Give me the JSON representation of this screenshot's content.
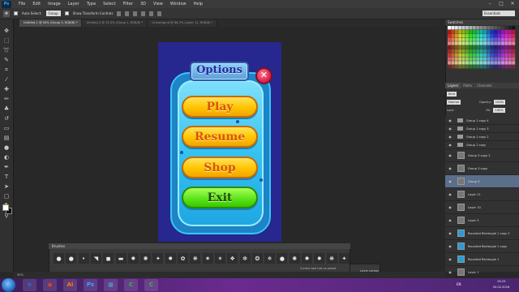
{
  "app": {
    "logo": "Ps"
  },
  "menu": [
    "File",
    "Edit",
    "Image",
    "Layer",
    "Type",
    "Select",
    "Filter",
    "3D",
    "View",
    "Window",
    "Help"
  ],
  "options_bar": {
    "auto_select_label": "Auto-Select:",
    "auto_select_value": "Group",
    "show_transform_label": "Show Transform Controls",
    "workspace": "Essentials"
  },
  "tabs": [
    "Untitled-1 @ 50% (Group 3, RGB/8) *",
    "Untitled-2 @ 33,3% (Group 1, RGB/8) *",
    "UI backgrnd @ 66,7% (Layer 11, RGB/8) *"
  ],
  "game_ui": {
    "title": "Options",
    "close_glyph": "✕",
    "buttons": [
      {
        "label": "Play",
        "color": "#ffc400"
      },
      {
        "label": "Resume",
        "color": "#ffc400"
      },
      {
        "label": "Shop",
        "color": "#ffc400"
      },
      {
        "label": "Exit",
        "color": "#5ee51a"
      }
    ]
  },
  "swatches_panel": {
    "title": "Swatches"
  },
  "layers_panel": {
    "tabs": [
      "Layers",
      "Paths",
      "Channels"
    ],
    "kind_filter": "Kind",
    "blend_mode": "Normal",
    "opacity_label": "Opacity:",
    "opacity_value": "100%",
    "lock_label": "Lock:",
    "fill_label": "Fill:",
    "fill_value": "100%",
    "layers": [
      {
        "name": "Group 1 copy 4",
        "type": "group",
        "selected": false
      },
      {
        "name": "Group 1 copy 3",
        "type": "group",
        "selected": false
      },
      {
        "name": "Group 1 copy 2",
        "type": "group",
        "selected": false
      },
      {
        "name": "Group 1 copy",
        "type": "group",
        "selected": false
      },
      {
        "name": "Group 3 copy 2",
        "type": "layer",
        "selected": false
      },
      {
        "name": "Group 3 copy",
        "type": "layer",
        "selected": false
      },
      {
        "name": "Group 3",
        "type": "layer",
        "selected": true
      },
      {
        "name": "Layer 11",
        "type": "layer",
        "selected": false
      },
      {
        "name": "Layer 10",
        "type": "layer",
        "selected": false
      },
      {
        "name": "Layer 3",
        "type": "layer",
        "selected": false
      },
      {
        "name": "Rounded Rectangle 1 copy 2",
        "type": "shape",
        "selected": false
      },
      {
        "name": "Rounded Rectangle 1 copy",
        "type": "shape",
        "selected": false
      },
      {
        "name": "Rounded Rectangle 1",
        "type": "shape",
        "selected": false
      },
      {
        "name": "Layer 1",
        "type": "layer",
        "selected": false
      }
    ]
  },
  "brush_panel": {
    "title": "Brushes",
    "status": "Current tool has no preset"
  },
  "mini_panel": {
    "label": "Layer comps"
  },
  "status_bar": {
    "zoom": "50%"
  },
  "taskbar": {
    "apps": [
      {
        "label": "e",
        "color": "#1e73d8"
      },
      {
        "label": "◉",
        "color": "#e14a2a"
      },
      {
        "label": "Ai",
        "color": "#ff7c00"
      },
      {
        "label": "Ps",
        "color": "#31a8ff"
      },
      {
        "label": "▦",
        "color": "#4aa0e0"
      },
      {
        "label": "C",
        "color": "#2fbd46"
      },
      {
        "label": "C",
        "color": "#2fbd46"
      }
    ],
    "lang": "EN",
    "time": "19:23",
    "date": "20.02.2016"
  }
}
